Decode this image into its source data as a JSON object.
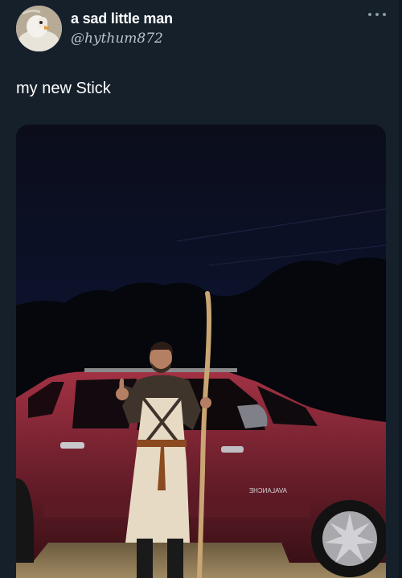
{
  "tweet": {
    "display_name": "a sad little man",
    "handle": "@hythum872",
    "text": "my new Stick"
  },
  "icons": {
    "more": "more-horizontal-icon",
    "avatar": "avatar-bird-photo"
  },
  "media": {
    "vehicle_badge": "AVALANCHE"
  },
  "colors": {
    "background": "#15202b",
    "text_primary": "#ffffff",
    "text_secondary": "#8b98a5"
  }
}
